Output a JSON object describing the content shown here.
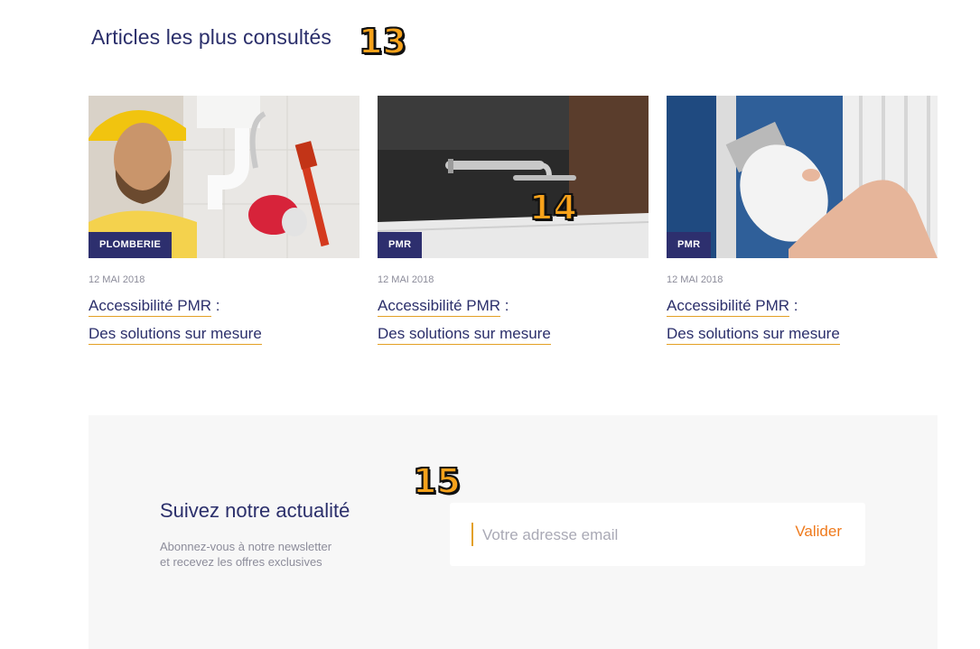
{
  "section": {
    "title": "Articles les plus consultés"
  },
  "markers": {
    "m13": "13",
    "m14": "14",
    "m15": "15"
  },
  "articles": [
    {
      "category": "PLOMBERIE",
      "date": "12 MAI 2018",
      "title_line1": "Accessibilité PMR",
      "title_colon": " :",
      "title_line2": "Des solutions sur mesure"
    },
    {
      "category": "PMR",
      "date": "12 MAI 2018",
      "title_line1": "Accessibilité PMR",
      "title_colon": " :",
      "title_line2": "Des solutions sur mesure"
    },
    {
      "category": "PMR",
      "date": "12 MAI 2018",
      "title_line1": "Accessibilité PMR",
      "title_colon": " :",
      "title_line2": "Des solutions sur mesure"
    }
  ],
  "newsletter": {
    "title": "Suivez notre actualité",
    "subtitle_line1": "Abonnez-vous à notre newsletter",
    "subtitle_line2": "et recevez les offres exclusives",
    "email_placeholder": "Votre adresse email",
    "submit_label": "Valider"
  },
  "colors": {
    "navy": "#2d2f6e",
    "accent_underline": "#e3a025",
    "submit": "#ef7a1c"
  }
}
